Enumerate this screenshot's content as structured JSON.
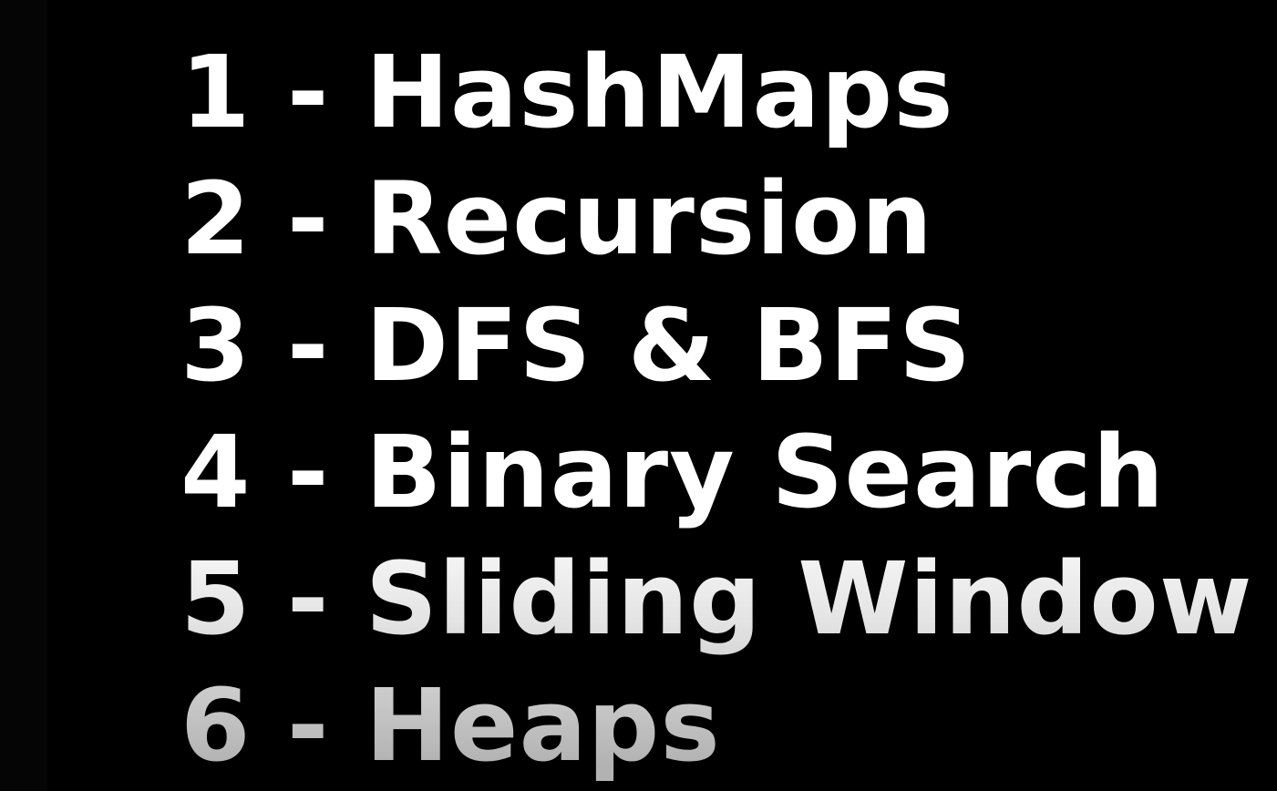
{
  "topics": [
    {
      "label": "1 - HashMaps"
    },
    {
      "label": "2 - Recursion"
    },
    {
      "label": "3 - DFS & BFS"
    },
    {
      "label": "4 - Binary Search"
    },
    {
      "label": "5 - Sliding Window"
    },
    {
      "label": "6 - Heaps"
    }
  ]
}
